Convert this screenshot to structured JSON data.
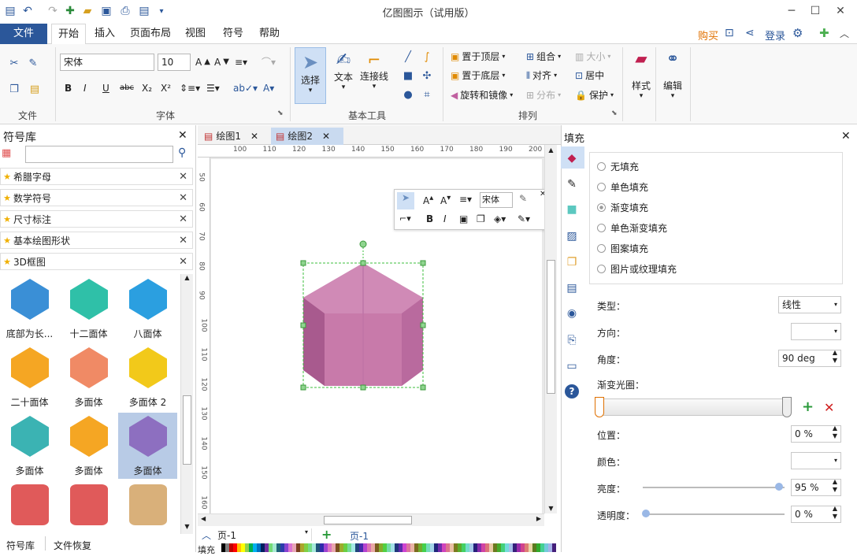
{
  "app_title": "亿图图示（试用版）",
  "menu": {
    "file": "文件",
    "tabs": [
      "开始",
      "插入",
      "页面布局",
      "视图",
      "符号",
      "帮助"
    ]
  },
  "account": {
    "buy": "购买",
    "login": "登录"
  },
  "ribbon": {
    "groups": [
      "文件",
      "字体",
      "基本工具",
      "排列",
      "样式",
      "编辑"
    ],
    "font_name": "宋体",
    "font_size": "10",
    "big_buttons": {
      "select": "选择",
      "text": "文本",
      "connector": "连接线",
      "style": "样式",
      "edit": "编辑"
    },
    "arrange": {
      "bring_front": "置于顶层",
      "send_back": "置于底层",
      "rotate": "旋转和镜像",
      "group": "组合",
      "align": "对齐",
      "distribute": "分布",
      "size": "大小",
      "center": "居中",
      "protect": "保护"
    }
  },
  "library": {
    "title": "符号库",
    "categories": [
      "希腊字母",
      "数学符号",
      "尺寸标注",
      "基本绘图形状",
      "3D框图"
    ],
    "shapes": [
      {
        "label": "底部为长...",
        "color": "#3a8fd6"
      },
      {
        "label": "十二面体",
        "color": "#2fc0a8"
      },
      {
        "label": "八面体",
        "color": "#2b9fe0"
      },
      {
        "label": "二十面体",
        "color": "#f5a623"
      },
      {
        "label": "多面体",
        "color": "#f08a65"
      },
      {
        "label": "多面体 2",
        "color": "#f2c91a"
      },
      {
        "label": "多面体",
        "color": "#3bb3b3"
      },
      {
        "label": "多面体",
        "color": "#f5a623"
      },
      {
        "label": "多面体",
        "color": "#8d6fc0"
      },
      {
        "label": "",
        "color": "#e05a5a"
      },
      {
        "label": "",
        "color": "#e05a5a"
      },
      {
        "label": "",
        "color": "#d9b07a"
      }
    ],
    "bottom_tabs": [
      "符号库",
      "文件恢复"
    ]
  },
  "doc_tabs": [
    "绘图1",
    "绘图2"
  ],
  "ruler": {
    "h": [
      "100",
      "110",
      "120",
      "130",
      "140",
      "150",
      "160",
      "170",
      "180",
      "190",
      "200"
    ],
    "v": [
      "50",
      "60",
      "70",
      "80",
      "90",
      "100",
      "110",
      "120",
      "130",
      "140",
      "150",
      "160"
    ]
  },
  "float_toolbar": {
    "font": "宋体"
  },
  "page_nav": {
    "page_select": "页-1",
    "page_tab": "页-1",
    "fill_label": "填充"
  },
  "fill_panel": {
    "title": "填充",
    "options": [
      "无填充",
      "单色填充",
      "渐变填充",
      "单色渐变填充",
      "图案填充",
      "图片或纹理填充"
    ],
    "selected": "渐变填充",
    "type_label": "类型：",
    "type_value": "线性",
    "direction_label": "方向：",
    "angle_label": "角度：",
    "angle_value": "90 deg",
    "gradient_label": "渐变光圈：",
    "position_label": "位置：",
    "position_value": "0 %",
    "color_label": "颜色：",
    "brightness_label": "亮度：",
    "brightness_value": "95 %",
    "transparency_label": "透明度：",
    "transparency_value": "0 %"
  },
  "colors": {
    "accent": "#2b579a",
    "shape": "#c878a8"
  }
}
